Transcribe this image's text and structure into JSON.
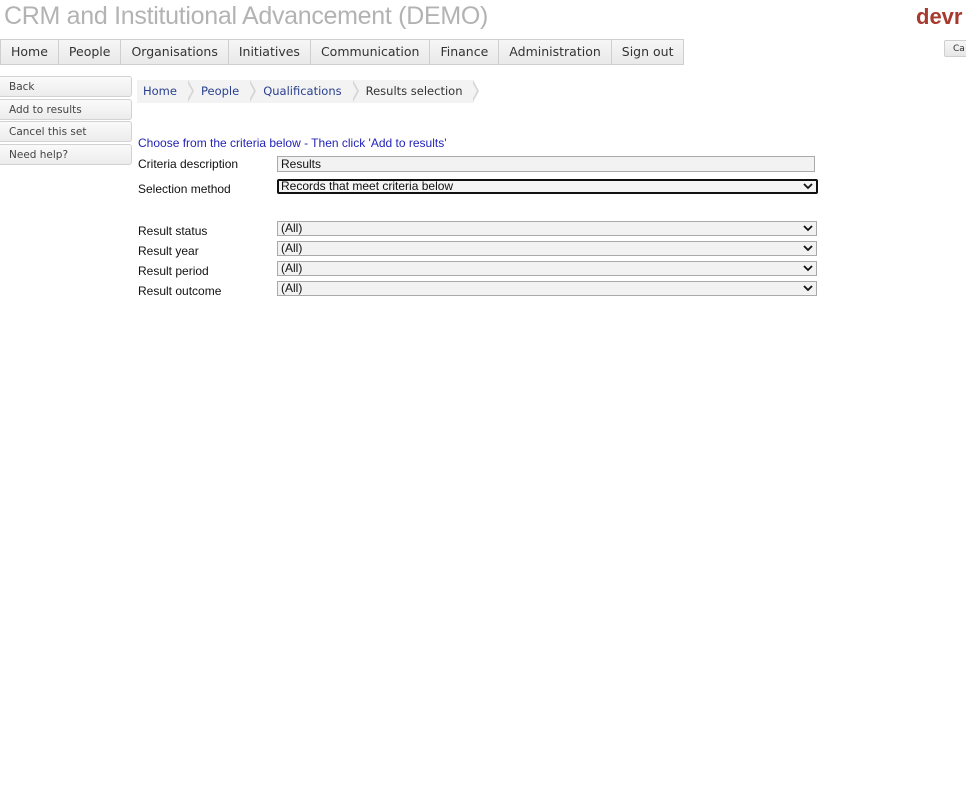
{
  "header": {
    "app_title": "CRM and Institutional Advancement (DEMO)",
    "brand_text": "devr",
    "brand_color": "#a63a2e",
    "mini_button_label": "Ca"
  },
  "topnav": {
    "items": [
      "Home",
      "People",
      "Organisations",
      "Initiatives",
      "Communication",
      "Finance",
      "Administration",
      "Sign out"
    ]
  },
  "sidebar": {
    "items": [
      "Back",
      "Add to results",
      "Cancel this set",
      "Need help?"
    ]
  },
  "breadcrumb": {
    "items": [
      "Home",
      "People",
      "Qualifications",
      "Results selection"
    ]
  },
  "form": {
    "instruction": "Choose from the criteria below - Then click 'Add to results'",
    "criteria_description": {
      "label": "Criteria description",
      "value": "Results"
    },
    "selection_method": {
      "label": "Selection method",
      "value": "Records that meet criteria below"
    },
    "result_status": {
      "label": "Result status",
      "value": "(All)"
    },
    "result_year": {
      "label": "Result year",
      "value": "(All)"
    },
    "result_period": {
      "label": "Result period",
      "value": "(All)"
    },
    "result_outcome": {
      "label": "Result outcome",
      "value": "(All)"
    }
  }
}
